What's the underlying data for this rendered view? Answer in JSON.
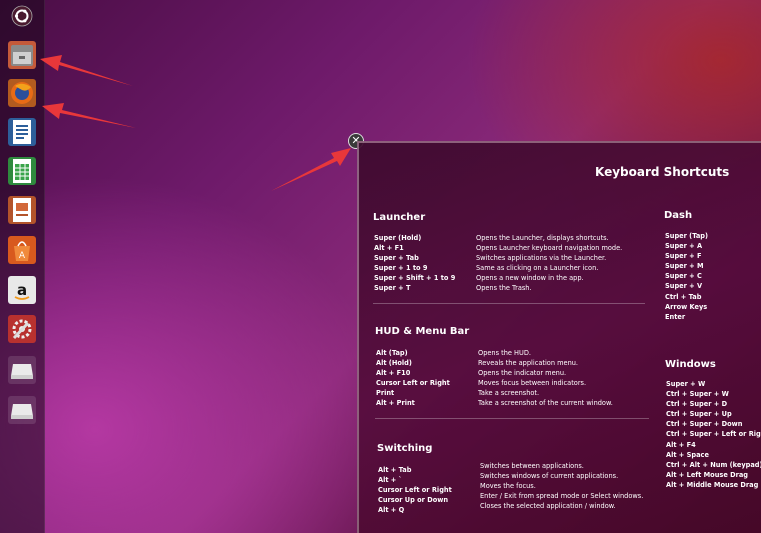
{
  "launcher": {
    "items": [
      {
        "name": "files",
        "icon": "file-cabinet-icon"
      },
      {
        "name": "firefox",
        "icon": "firefox-icon"
      },
      {
        "name": "writer",
        "icon": "libreoffice-writer-icon"
      },
      {
        "name": "calc",
        "icon": "libreoffice-calc-icon"
      },
      {
        "name": "impress",
        "icon": "libreoffice-impress-icon"
      },
      {
        "name": "software-center",
        "icon": "shopping-bag-icon"
      },
      {
        "name": "amazon",
        "icon": "amazon-icon"
      },
      {
        "name": "system-settings",
        "icon": "wrench-gear-icon"
      },
      {
        "name": "drive-1",
        "icon": "drive-icon"
      },
      {
        "name": "drive-2",
        "icon": "drive-icon"
      }
    ]
  },
  "colors": {
    "arrow": "#e8373a",
    "close_bg": "#3a3a3a"
  },
  "overlay": {
    "title": "Keyboard Shortcuts",
    "launcher": {
      "heading": "Launcher",
      "keys": [
        "Super (Hold)",
        "Alt + F1",
        "Super + Tab",
        "Super + 1 to 9",
        "Super + Shift + 1 to 9",
        "Super + T"
      ],
      "descs": [
        "Opens the Launcher, displays shortcuts.",
        "Opens Launcher keyboard navigation mode.",
        "Switches applications via the Launcher.",
        "Same as clicking on a Launcher icon.",
        "Opens a new window in the app.",
        "Opens the Trash."
      ]
    },
    "hud": {
      "heading": "HUD & Menu Bar",
      "keys": [
        "Alt (Tap)",
        "Alt (Hold)",
        "Alt + F10",
        "Cursor Left or Right",
        "Print",
        "Alt + Print"
      ],
      "descs": [
        "Opens the HUD.",
        "Reveals the application menu.",
        "Opens the indicator menu.",
        "Moves focus between indicators.",
        "Take a screenshot.",
        "Take a screenshot of the current window."
      ]
    },
    "switching": {
      "heading": "Switching",
      "keys": [
        "Alt + Tab",
        "Alt + `",
        "Cursor Left or Right",
        "Cursor Up or Down",
        "Alt + Q"
      ],
      "descs": [
        "Switches between applications.",
        "Switches windows of current applications.",
        "Moves the focus.",
        "Enter / Exit from spread mode or Select windows.",
        "Closes the selected application / window."
      ]
    },
    "dash": {
      "heading": "Dash",
      "keys": [
        "Super (Tap)",
        "Super + A",
        "Super + F",
        "Super + M",
        "Super + C",
        "Super + V",
        "Ctrl + Tab",
        "Arrow Keys",
        "Enter"
      ]
    },
    "windows": {
      "heading": "Windows",
      "keys": [
        "Super + W",
        "Ctrl + Super + W",
        "Ctrl + Super + D",
        "Ctrl + Super + Up",
        "Ctrl + Super + Down",
        "Ctrl + Super + Left or Right",
        "Alt + F4",
        "Alt + Space",
        "Ctrl + Alt + Num (keypad)",
        "Alt + Left Mouse Drag",
        "Alt + Middle Mouse Drag"
      ]
    }
  }
}
